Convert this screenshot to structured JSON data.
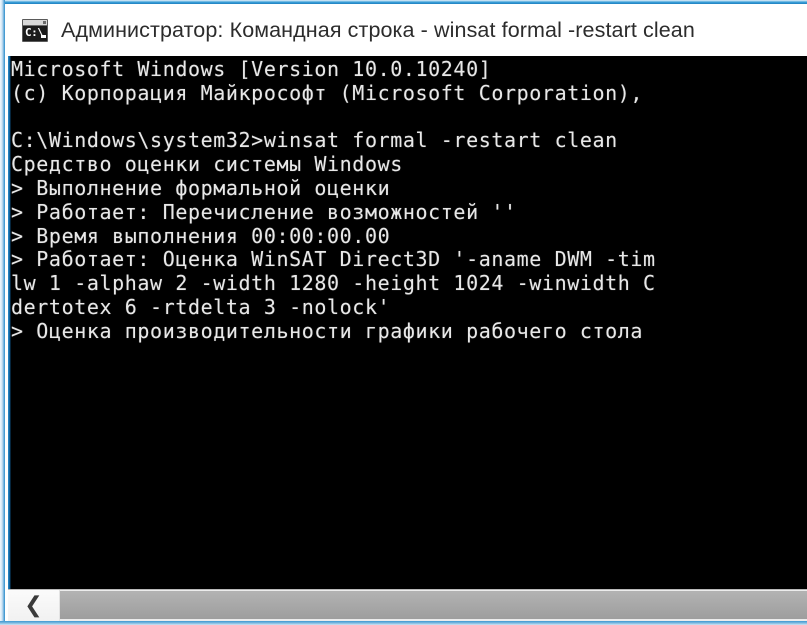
{
  "window": {
    "title": "Администратор: Командная строка - winsat formal -restart clean",
    "icon_name": "cmd-icon",
    "icon_prompt_text": "C:\\",
    "border_color": "#3b9fd8",
    "titlebar_bg": "#ffffff",
    "console_bg": "#000000",
    "console_fg": "#e8e8e8"
  },
  "console": {
    "lines": [
      "Microsoft Windows [Version 10.0.10240]",
      "(c) Корпорация Майкрософт (Microsoft Corporation),",
      "",
      "C:\\Windows\\system32>winsat formal -restart clean",
      "Средство оценки системы Windows",
      "> Выполнение формальной оценки",
      "> Работает: Перечисление возможностей ''",
      "> Время выполнения 00:00:00.00",
      "> Работает: Оценка WinSAT Direct3D '-aname DWM -tim",
      "lw 1 -alphaw 2 -width 1280 -height 1024 -winwidth C",
      "dertotex 6 -rtdelta 3 -nolock'",
      "> Оценка производительности графики рабочего стола"
    ]
  },
  "scrollbar": {
    "left_arrow_glyph": "❮",
    "orientation": "horizontal",
    "thumb_color": "#a8a8a8",
    "track_color": "#ececec"
  }
}
